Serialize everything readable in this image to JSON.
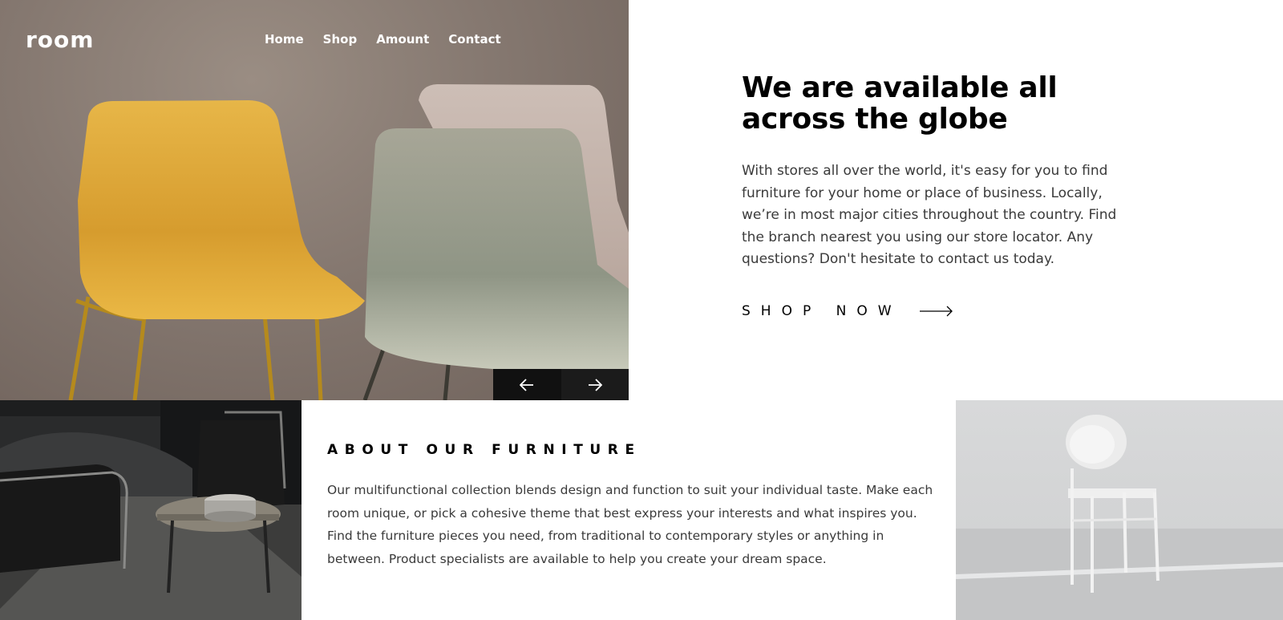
{
  "header": {
    "logo": "room",
    "nav": [
      "Home",
      "Shop",
      "Amount",
      "Contact"
    ]
  },
  "hero": {
    "image": "yellow-and-gray-chairs-photo",
    "prev_icon": "arrow-left-icon",
    "next_icon": "arrow-right-icon"
  },
  "main": {
    "headline": "We are available all across the globe",
    "description": "With stores all over the world, it's easy for you to find furniture for your home or place of business. Locally, we’re in most major cities throughout the country. Find the branch nearest you using our store locator. Any questions? Don't hesitate to contact us today.",
    "cta_label": "SHOP NOW",
    "cta_icon": "long-arrow-right-icon"
  },
  "about": {
    "title": "ABOUT OUR FURNITURE",
    "text": "Our multifunctional collection blends design and function to suit your individual taste. Make each room unique, or pick a cohesive theme that best express your interests and what inspires you. Find the furniture pieces you need, from traditional to contemporary styles or anything in between. Product specialists are available to help you create your dream space.",
    "image_left": "dark-living-room-photo",
    "image_right": "white-chair-photo"
  },
  "colors": {
    "text_primary": "#000000",
    "text_body": "#3a3a3a",
    "control_bg": "#111111",
    "nav_text": "#ffffff"
  }
}
